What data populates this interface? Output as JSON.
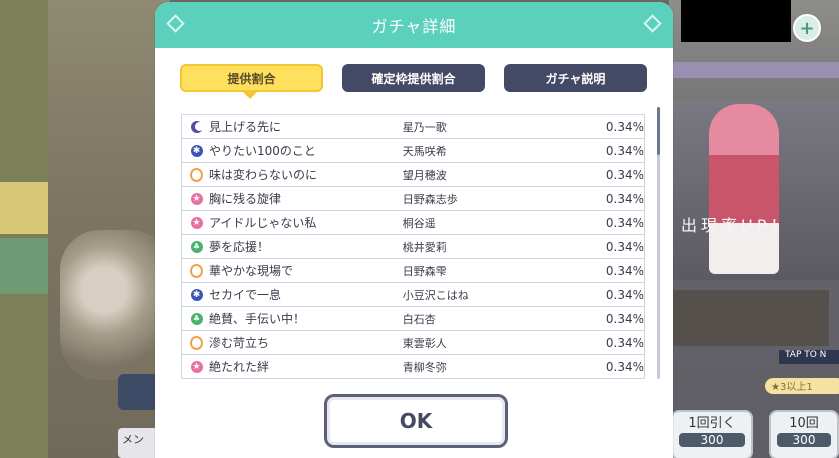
{
  "dialog": {
    "title": "ガチャ詳細",
    "ok_label": "OK"
  },
  "tabs": [
    {
      "label": "提供割合",
      "active": true
    },
    {
      "label": "確定枠提供割合",
      "active": false
    },
    {
      "label": "ガチャ説明",
      "active": false
    }
  ],
  "rates": [
    {
      "icon": "moon-icon",
      "title": "見上げる先に",
      "member": "星乃一歌",
      "rate": "0.34%"
    },
    {
      "icon": "snowflake-icon",
      "title": "やりたい100のこと",
      "member": "天馬咲希",
      "rate": "0.34%"
    },
    {
      "icon": "heart-icon",
      "title": "味は変わらないのに",
      "member": "望月穂波",
      "rate": "0.34%"
    },
    {
      "icon": "star-icon",
      "title": "胸に残る旋律",
      "member": "日野森志歩",
      "rate": "0.34%"
    },
    {
      "icon": "star-icon",
      "title": "アイドルじゃない私",
      "member": "桐谷遥",
      "rate": "0.34%"
    },
    {
      "icon": "sprout-icon",
      "title": "夢を応援！",
      "member": "桃井愛莉",
      "rate": "0.34%"
    },
    {
      "icon": "heart-icon",
      "title": "華やかな現場で",
      "member": "日野森雫",
      "rate": "0.34%"
    },
    {
      "icon": "snowflake-icon",
      "title": "セカイで一息",
      "member": "小豆沢こはね",
      "rate": "0.34%"
    },
    {
      "icon": "sprout-icon",
      "title": "絶賛、手伝い中！",
      "member": "白石杏",
      "rate": "0.34%"
    },
    {
      "icon": "heart-icon",
      "title": "滲む苛立ち",
      "member": "東雲彰人",
      "rate": "0.34%"
    },
    {
      "icon": "star-icon",
      "title": "絶たれた絆",
      "member": "青柳冬弥",
      "rate": "0.34%"
    }
  ],
  "background": {
    "plus_label": "+",
    "up_text": "出現率UP！",
    "tap_label": "TAP TO N",
    "star_badge": "★3以上1",
    "pull_single": {
      "label": "1回引く",
      "cost": "300"
    },
    "pull_ten": {
      "label": "10回",
      "cost": "300"
    },
    "menu_label": "メン"
  },
  "colors": {
    "header": "#5bd0bd",
    "tab_active": "#ffe05c",
    "tab_inactive": "#444a66"
  }
}
